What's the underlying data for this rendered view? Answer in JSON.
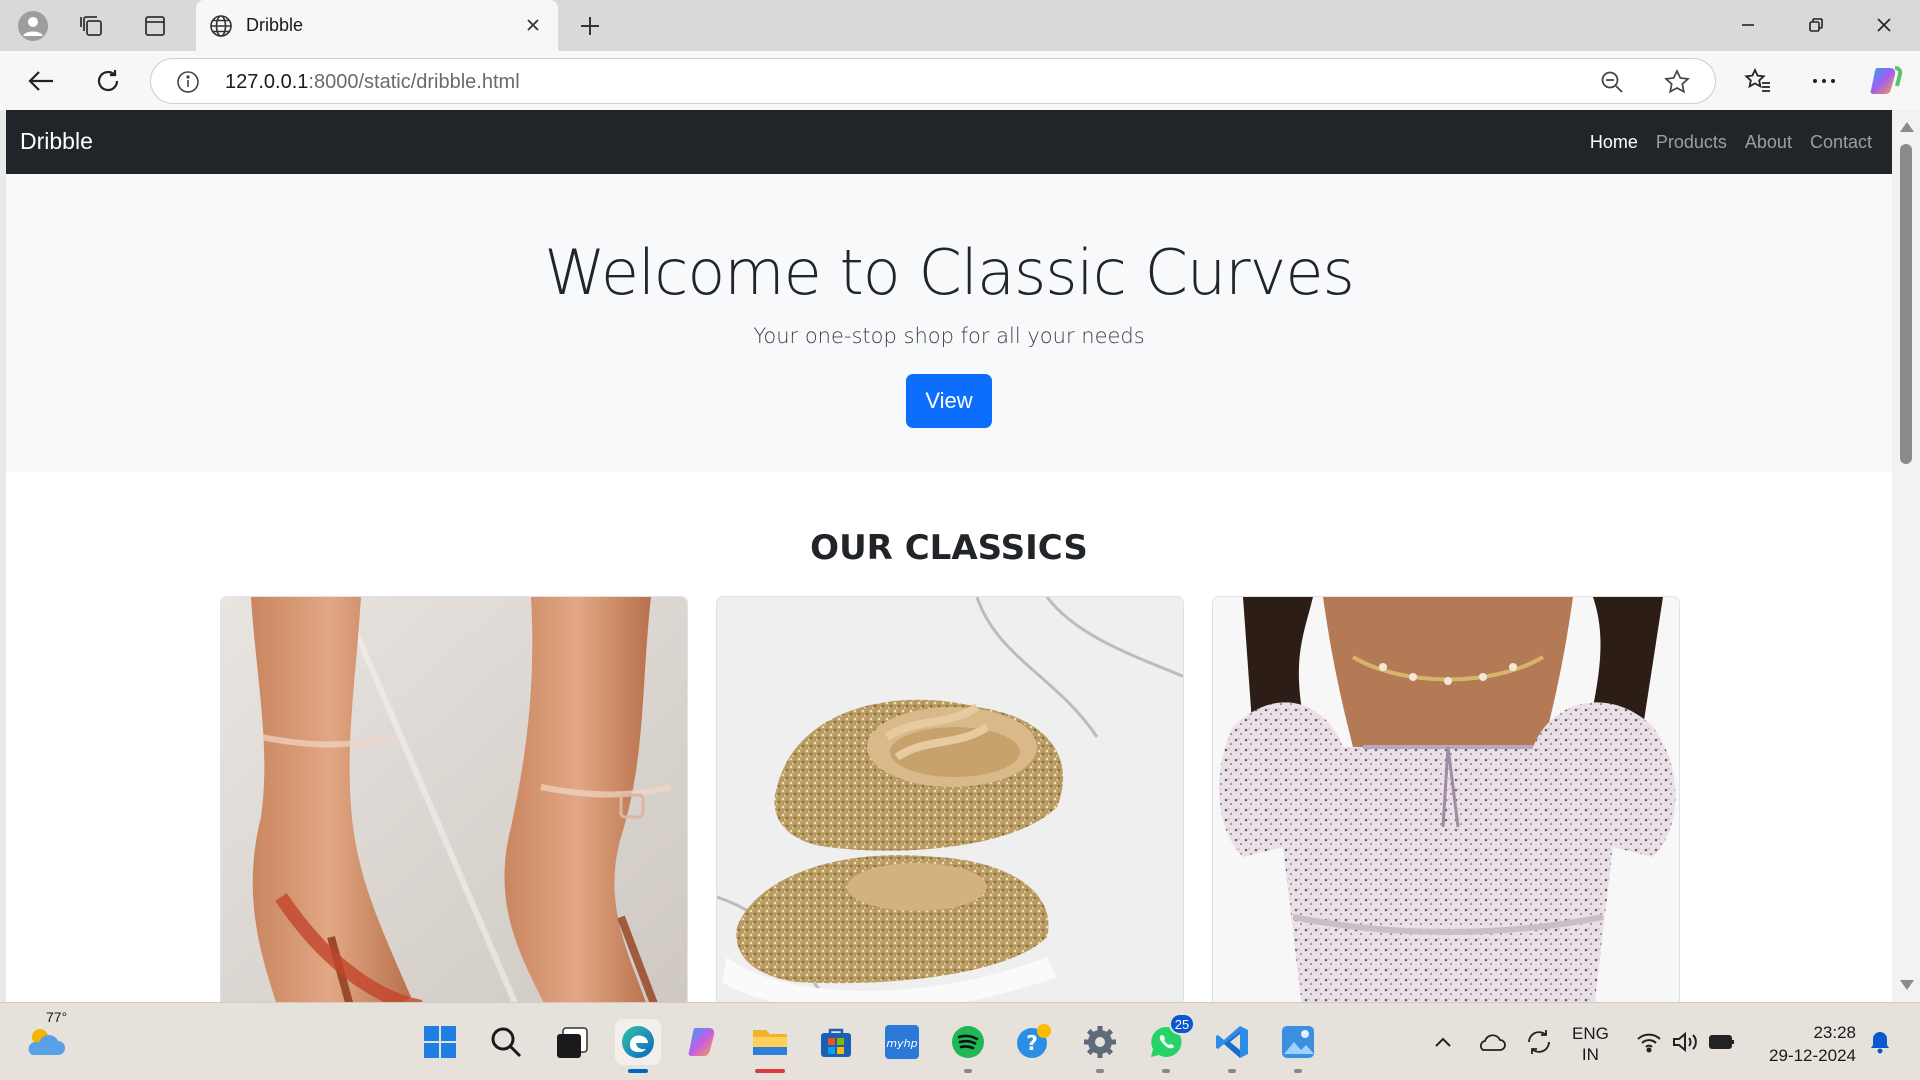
{
  "browser": {
    "tab_title": "Dribble",
    "url_host": "127.0.0.1",
    "url_path": ":8000/static/dribble.html"
  },
  "site": {
    "brand": "Dribble",
    "nav": [
      "Home",
      "Products",
      "About",
      "Contact"
    ],
    "active_nav": "Home"
  },
  "hero": {
    "title": "Welcome to Classic Curves",
    "subtitle": "Your one-stop shop for all your needs",
    "button": "View"
  },
  "section": {
    "title": "OUR CLASSICS",
    "cards": [
      {
        "image": "clear-strap-heels"
      },
      {
        "image": "gold-glitter-sneakers"
      },
      {
        "image": "floral-puff-sleeve-top"
      }
    ]
  },
  "taskbar": {
    "weather_temp": "77°",
    "whatsapp_badge": "25",
    "lang_line1": "ENG",
    "lang_line2": "IN",
    "time": "23:28",
    "date": "29-12-2024"
  },
  "colors": {
    "navbar": "#212529",
    "hero_bg": "#f8f9fa",
    "primary": "#0d6efd"
  }
}
